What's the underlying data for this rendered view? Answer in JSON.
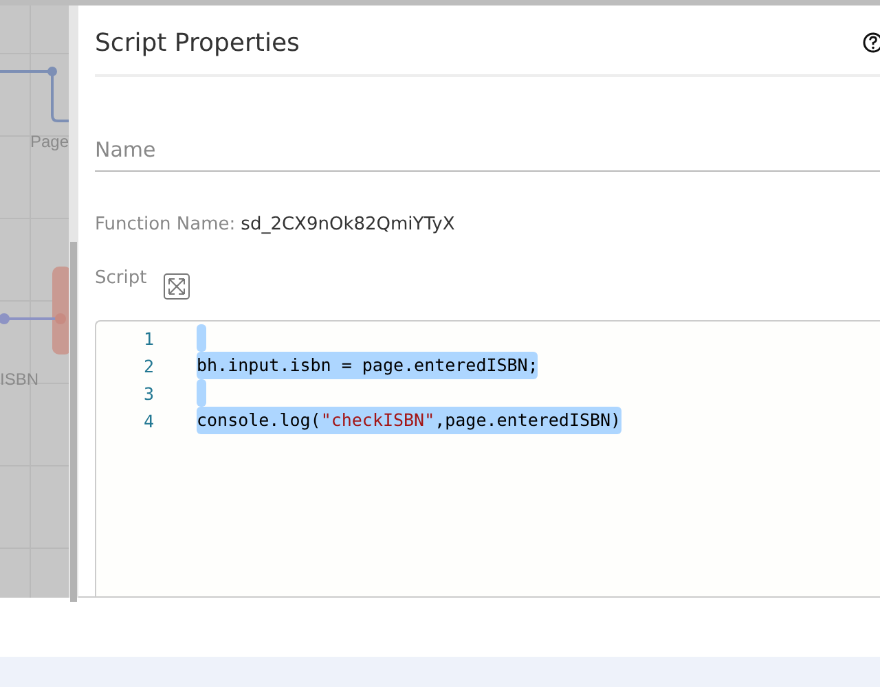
{
  "canvas": {
    "labels": [
      "Page",
      "ISBN"
    ]
  },
  "panel": {
    "title": "Script Properties",
    "name_field": {
      "placeholder": "Name"
    },
    "function_name": {
      "label": "Function Name:",
      "value": "sd_2CX9nOk82QmiYTyX"
    },
    "script_label": "Script",
    "editor": {
      "lines": [
        {
          "number": "1",
          "selected": true
        },
        {
          "number": "2",
          "selected": true,
          "tokens": [
            {
              "kind": "plain",
              "text": "bh.input.isbn = page.enteredISBN;"
            }
          ]
        },
        {
          "number": "3",
          "selected": true
        },
        {
          "number": "4",
          "selected": true,
          "tokens": [
            {
              "kind": "plain",
              "text": "console.log("
            },
            {
              "kind": "string",
              "text": "\"checkISBN\""
            },
            {
              "kind": "plain",
              "text": ",page.enteredISBN)"
            }
          ]
        }
      ]
    }
  }
}
